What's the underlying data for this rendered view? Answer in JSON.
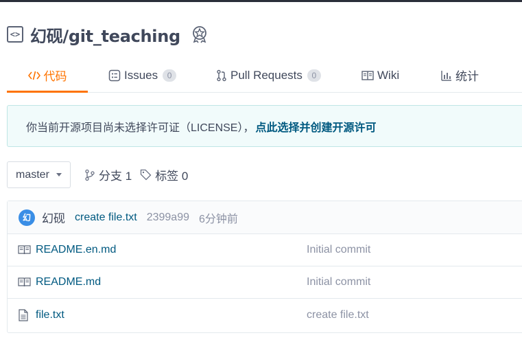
{
  "repo": {
    "title": "幻砚/git_teaching",
    "icon": "code-bracket-icon",
    "badge_icon": "award-icon"
  },
  "tabs": [
    {
      "label": "代码",
      "icon": "code-icon",
      "active": true
    },
    {
      "label": "Issues",
      "icon": "issue-icon",
      "count": "0"
    },
    {
      "label": "Pull Requests",
      "icon": "pull-request-icon",
      "count": "0"
    },
    {
      "label": "Wiki",
      "icon": "book-icon"
    },
    {
      "label": "统计",
      "icon": "bar-chart-icon"
    }
  ],
  "license_notice": {
    "text": "你当前开源项目尚未选择许可证（LICENSE），",
    "link": "点此选择并创建开源许可"
  },
  "branch_bar": {
    "selected_branch": "master",
    "branches_label": "分支 1",
    "tags_label": "标签 0"
  },
  "last_commit": {
    "avatar_text": "幻",
    "author": "幻砚",
    "message": "create file.txt",
    "sha": "2399a99",
    "time": "6分钟前"
  },
  "files": [
    {
      "name": "README.en.md",
      "commit": "Initial commit",
      "icon": "readme-book-icon"
    },
    {
      "name": "README.md",
      "commit": "Initial commit",
      "icon": "readme-book-icon"
    },
    {
      "name": "file.txt",
      "commit": "create file.txt",
      "icon": "file-icon"
    }
  ],
  "colors": {
    "accent": "#fe7300",
    "link": "#005980",
    "muted": "#8c92a4",
    "license_bg": "#f1fbfb"
  }
}
